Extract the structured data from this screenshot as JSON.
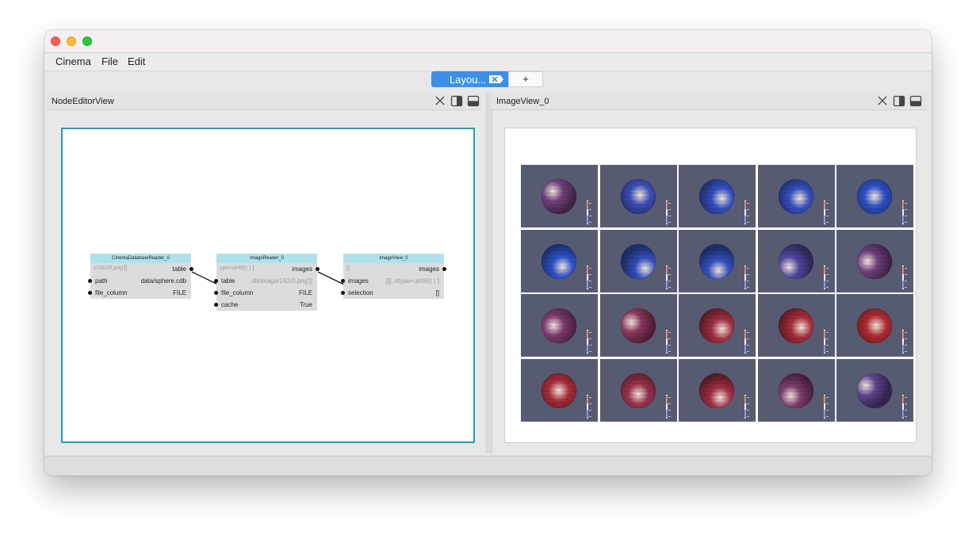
{
  "menubar": {
    "items": [
      "Cinema",
      "File",
      "Edit"
    ]
  },
  "tabs": {
    "active_label": "Layou...",
    "add_label": "+"
  },
  "node_editor": {
    "title": "NodeEditorView",
    "nodes": [
      {
        "title": "CinemaDatabaseReader_0",
        "ports": [
          {
            "ghost": "e/162/0.png']]",
            "name": "",
            "value": "table",
            "faded": false,
            "in": false,
            "out": true
          },
          {
            "name": "path",
            "value": "data/sphere.cdb",
            "faded": false,
            "in": true,
            "out": false
          },
          {
            "name": "file_column",
            "value": "FILE",
            "faded": false,
            "in": true,
            "out": false
          }
        ]
      },
      {
        "title": "ImageReader_0",
        "ports": [
          {
            "ghost": "ype=uint8)) ) ]",
            "name": "",
            "value": "images",
            "faded": false,
            "in": false,
            "out": true
          },
          {
            "name": "table",
            "value": "db/image/162/0.png']]",
            "faded": true,
            "in": true,
            "out": false
          },
          {
            "name": "file_column",
            "value": "FILE",
            "faded": false,
            "in": true,
            "out": false
          },
          {
            "name": "cache",
            "value": "True",
            "faded": false,
            "in": true,
            "out": false
          }
        ]
      },
      {
        "title": "ImageView_0",
        "ports": [
          {
            "ghost": "[]",
            "name": "",
            "value": "images",
            "faded": false,
            "in": false,
            "out": true
          },
          {
            "name": "images",
            "value": "]]], dtype=uint8)) ) ]",
            "faded": true,
            "in": true,
            "out": false
          },
          {
            "name": "selection",
            "value": "[]",
            "faded": false,
            "in": true,
            "out": false
          }
        ]
      }
    ]
  },
  "image_view": {
    "title": "ImageView_0",
    "thumbnails": [
      {
        "red": 0.45,
        "light": [
          -0.35,
          -0.3
        ]
      },
      {
        "red": 0.1,
        "light": [
          0.1,
          -0.1
        ]
      },
      {
        "red": 0.05,
        "light": [
          0.3,
          0.1
        ]
      },
      {
        "red": 0.05,
        "light": [
          0.2,
          0.1
        ]
      },
      {
        "red": 0.0,
        "light": [
          0.0,
          0.0
        ]
      },
      {
        "red": 0.0,
        "light": [
          0.2,
          0.3
        ]
      },
      {
        "red": 0.05,
        "light": [
          0.4,
          0.4
        ]
      },
      {
        "red": 0.05,
        "light": [
          0.1,
          0.5
        ]
      },
      {
        "red": 0.25,
        "light": [
          -0.4,
          0.3
        ]
      },
      {
        "red": 0.45,
        "light": [
          -0.4,
          0.0
        ]
      },
      {
        "red": 0.55,
        "light": [
          -0.3,
          0.0
        ]
      },
      {
        "red": 0.65,
        "light": [
          -0.4,
          -0.2
        ]
      },
      {
        "red": 0.8,
        "light": [
          0.3,
          0.2
        ]
      },
      {
        "red": 0.85,
        "light": [
          0.3,
          0.1
        ]
      },
      {
        "red": 0.9,
        "light": [
          0.1,
          0.0
        ]
      },
      {
        "red": 0.85,
        "light": [
          0.0,
          0.0
        ]
      },
      {
        "red": 0.75,
        "light": [
          0.0,
          0.2
        ]
      },
      {
        "red": 0.8,
        "light": [
          0.2,
          0.4
        ]
      },
      {
        "red": 0.55,
        "light": [
          -0.3,
          0.3
        ]
      },
      {
        "red": 0.35,
        "light": [
          -0.5,
          -0.3
        ]
      }
    ]
  },
  "colors": {
    "accent": "#3d8fe8",
    "node_header": "#aee1eb",
    "canvas_border": "#2a9bb0",
    "thumb_bg": "#575b72"
  }
}
